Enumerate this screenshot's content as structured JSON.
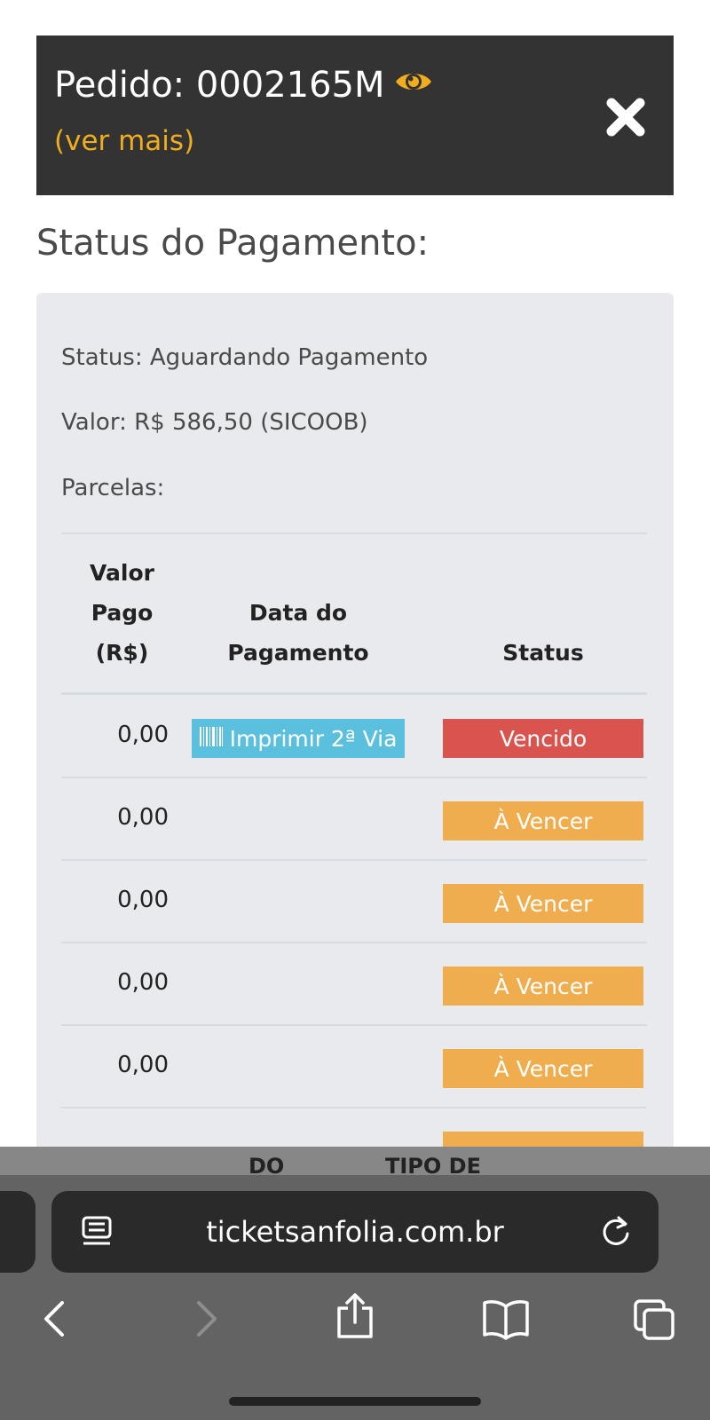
{
  "order": {
    "title": "Pedido: 0002165M",
    "see_more": "(ver mais)"
  },
  "section_title": "Status do Pagamento:",
  "payment": {
    "status_line": "Status: Aguardando Pagamento",
    "value_line": "Valor: R$ 586,50 (SICOOB)",
    "installments_label": "Parcelas:"
  },
  "table": {
    "headers": {
      "col1_line1": "Valor",
      "col1_line2": "Pago",
      "col1_line3": "(R$)",
      "col2_line1": "Data do",
      "col2_line2": "Pagamento",
      "col3": "Status"
    },
    "rows": [
      {
        "value": "0,00",
        "action": "Imprimir 2ª Via",
        "status": "Vencido"
      },
      {
        "value": "0,00",
        "status": "À Vencer"
      },
      {
        "value": "0,00",
        "status": "À Vencer"
      },
      {
        "value": "0,00",
        "status": "À Vencer"
      },
      {
        "value": "0,00",
        "status": "À Vencer"
      }
    ],
    "next_headers_peek": {
      "col1": "DO",
      "col2": "TIPO DE"
    }
  },
  "browser": {
    "url": "ticketsanfolia.com.br"
  },
  "icons": {
    "eye": "eye-icon",
    "close": "close-icon",
    "barcode": "barcode-icon",
    "reader": "reader-mode-icon",
    "reload": "reload-icon",
    "back": "back-icon",
    "forward": "forward-icon",
    "share": "share-icon",
    "bookmarks": "bookmarks-icon",
    "tabs": "tabs-icon"
  },
  "colors": {
    "header_bg": "#333333",
    "accent_yellow": "#f0ad1e",
    "print_button": "#5bc0de",
    "overdue": "#d9534f",
    "upcoming": "#f0ad4e"
  }
}
